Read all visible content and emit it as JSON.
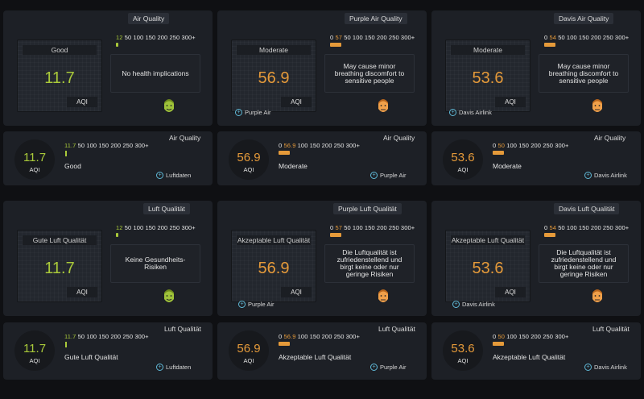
{
  "colors": {
    "good": "#a9c93a",
    "moderate": "#e59a3a",
    "background": "#0f1013",
    "card": "#1d2026"
  },
  "icons": {
    "face": "face-icon",
    "source": "plus-circle-icon"
  },
  "scale_tail": "50 100 150 200 250 300+",
  "scale_tail_zero": "100 150 200 250 300+",
  "large": [
    {
      "title": "Air Quality",
      "label": "Good",
      "value": "11.7",
      "aqi": "AQI",
      "marker": "12",
      "description": "No health implications",
      "source": "",
      "level": "good"
    },
    {
      "title": "Purple Air Quality",
      "label": "Moderate",
      "value": "56.9",
      "aqi": "AQI",
      "marker": "57",
      "description": "May cause minor breathing discomfort to sensitive people",
      "source": "Purple Air",
      "level": "moderate"
    },
    {
      "title": "Davis Air Quality",
      "label": "Moderate",
      "value": "53.6",
      "aqi": "AQI",
      "marker": "54",
      "description": "May cause minor breathing discomfort to sensitive people",
      "source": "Davis Airlink",
      "level": "moderate"
    },
    {
      "title": "Luft Qualität",
      "label": "Gute Luft Qualität",
      "value": "11.7",
      "aqi": "AQI",
      "marker": "12",
      "description": "Keine Gesundheits-Risiken",
      "source": "",
      "level": "good"
    },
    {
      "title": "Purple Luft Qualität",
      "label": "Akzeptable Luft Qualität",
      "value": "56.9",
      "aqi": "AQI",
      "marker": "57",
      "description": "Die Luftqualität ist zufriedenstellend und birgt keine oder nur geringe Risiken",
      "source": "Purple Air",
      "level": "moderate"
    },
    {
      "title": "Davis Luft Qualität",
      "label": "Akzeptable Luft Qualität",
      "value": "53.6",
      "aqi": "AQI",
      "marker": "54",
      "description": "Die Luftqualität ist zufriedenstellend und birgt keine oder nur geringe Risiken",
      "source": "Davis Airlink",
      "level": "moderate"
    }
  ],
  "small": [
    {
      "title": "Air Quality",
      "value": "11.7",
      "aqi": "AQI",
      "marker": "11.7",
      "status": "Good",
      "source": "Luftdaten",
      "level": "good"
    },
    {
      "title": "Air Quality",
      "value": "56.9",
      "aqi": "AQI",
      "marker": "56.9",
      "status": "Moderate",
      "source": "Purple Air",
      "level": "moderate"
    },
    {
      "title": "Air Quality",
      "value": "53.6",
      "aqi": "AQI",
      "marker": "50",
      "status": "Moderate",
      "source": "Davis Airlink",
      "level": "moderate"
    },
    {
      "title": "Luft Qualität",
      "value": "11.7",
      "aqi": "AQI",
      "marker": "11.7",
      "status": "Gute Luft Qualität",
      "source": "Luftdaten",
      "level": "good"
    },
    {
      "title": "Luft Qualität",
      "value": "56.9",
      "aqi": "AQI",
      "marker": "56.9",
      "status": "Akzeptable Luft Qualität",
      "source": "Purple Air",
      "level": "moderate"
    },
    {
      "title": "Luft Qualität",
      "value": "53.6",
      "aqi": "AQI",
      "marker": "50",
      "status": "Akzeptable Luft Qualität",
      "source": "Davis Airlink",
      "level": "moderate"
    }
  ]
}
